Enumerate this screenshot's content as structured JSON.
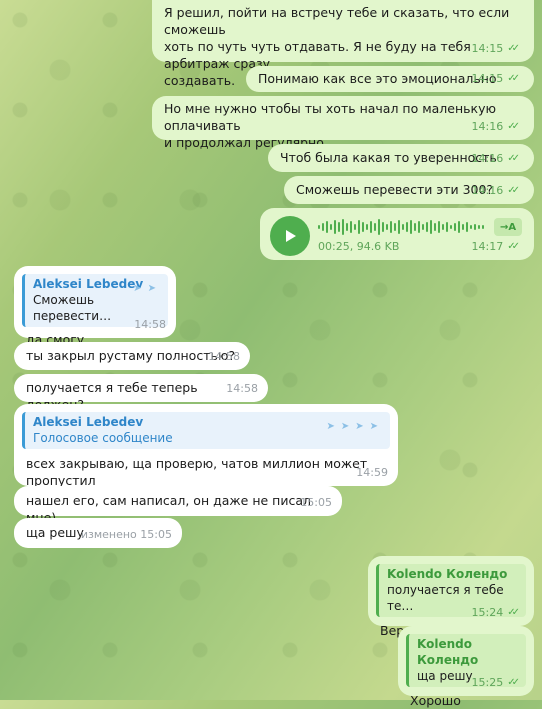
{
  "messages": [
    {
      "text": "Я решил, пойти на встречу тебе и сказать, что если сможешь\nхоть по чуть чуть отдавать. Я не буду на тебя арбитраж сразу\nсоздавать.",
      "time": "14:15"
    },
    {
      "text": "Понимаю как все это эмоционально",
      "time": "14:15"
    },
    {
      "text": "Но мне нужно чтобы ты хоть начал по маленькую оплачивать\nи продолжал регулярно",
      "time": "14:16"
    },
    {
      "text": "Чтоб была какая то уверенность",
      "time": "14:16"
    },
    {
      "text": "Сможешь перевести эти 300?",
      "time": "14:16"
    },
    {
      "voice_duration": "00:25, 94.6 KB",
      "transcribe": "→A",
      "time": "14:17"
    },
    {
      "reply_name": "Aleksei Lebedev",
      "reply_text": "Сможешь перевести…",
      "text": "да смогу",
      "time": "14:58"
    },
    {
      "text": "ты закрыл рустаму полностью?",
      "time": "14:58"
    },
    {
      "text": "получается я тебе теперь должен?",
      "time": "14:58"
    },
    {
      "reply_name": "Aleksei Lebedev",
      "reply_text": "Голосовое сообщение",
      "text": "всех закрываю, ща проверю, чатов миллион может пропустил",
      "time": "14:59"
    },
    {
      "text": "нашел его, сам написал, он даже не писал мне)",
      "time": "15:05"
    },
    {
      "text": "ща решу",
      "time": "изменено 15:05"
    },
    {
      "reply_name": "Kolendo Колендо",
      "reply_text": "получается я тебе те…",
      "text": "Верно",
      "time": "15:24"
    },
    {
      "reply_name": "Kolendo Колендо",
      "reply_text": "ща решу",
      "text": "Хорошо",
      "time": "15:25"
    }
  ]
}
